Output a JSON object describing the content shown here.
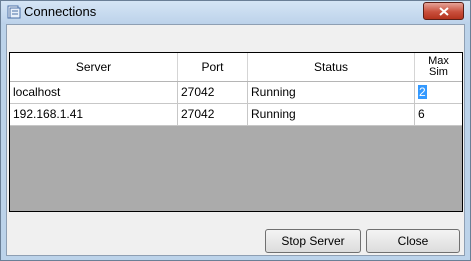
{
  "window": {
    "title": "Connections",
    "icon": "connections-app-icon",
    "close_icon": "close-icon"
  },
  "grid": {
    "columns": [
      "Server",
      "Port",
      "Status",
      "Max\nSim"
    ],
    "column_max_sim_line1": "Max",
    "column_max_sim_line2": "Sim",
    "rows": [
      {
        "server": "localhost",
        "port": "27042",
        "status": "Running",
        "max_sim": "2",
        "editing": true
      },
      {
        "server": "192.168.1.41",
        "port": "27042",
        "status": "Running",
        "max_sim": "6",
        "editing": false
      }
    ]
  },
  "buttons": {
    "stop_server": "Stop Server",
    "close": "Close"
  },
  "colors": {
    "titlebar": "#bcd3ea",
    "close_button": "#c9503d",
    "grid_empty_area": "#ababab",
    "selection": "#3399ff"
  }
}
